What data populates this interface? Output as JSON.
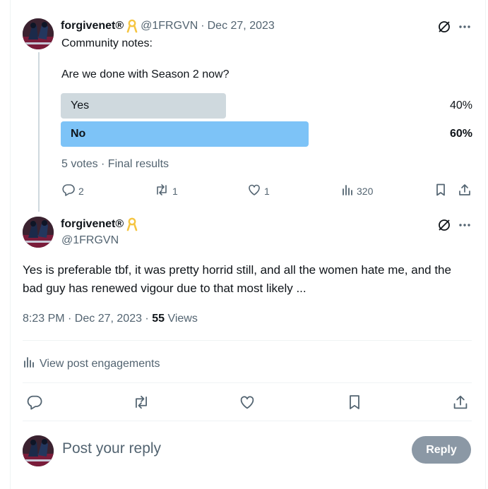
{
  "parent_tweet": {
    "display_name": "forgivenet®",
    "handle": "@1FRGVN",
    "separator": "·",
    "date": "Dec 27, 2023",
    "text_line1": "Community notes:",
    "text_line2": "Are we done with Season 2 now?",
    "poll": {
      "options": [
        {
          "label": "Yes",
          "percent": "40%",
          "share": 0.4,
          "winner": false
        },
        {
          "label": "No",
          "percent": "60%",
          "share": 0.6,
          "winner": true
        }
      ],
      "summary": "5 votes · Final results"
    },
    "actions": {
      "replies": "2",
      "reposts": "1",
      "likes": "1",
      "views": "320"
    }
  },
  "main_tweet": {
    "display_name": "forgivenet®",
    "handle": "@1FRGVN",
    "text": "Yes is preferable tbf, it was pretty horrid still, and all the women hate me, and the bad guy has renewed vigour due to that most likely ...",
    "timestamp": "8:23 PM · Dec 27, 2023 · ",
    "views_count": "55",
    "views_label": " Views",
    "engagements_label": "View post engagements"
  },
  "reply_box": {
    "placeholder": "Post your reply",
    "button_label": "Reply"
  },
  "colors": {
    "winner_bar": "#7dc3f7",
    "loser_bar": "#cfd9de",
    "muted_text": "#536471",
    "reply_button": "#8b98a5"
  },
  "icons": [
    "grok-icon",
    "more-icon",
    "ribbon-icon",
    "reply-icon",
    "repost-icon",
    "like-icon",
    "views-icon",
    "bookmark-icon",
    "share-icon",
    "engagements-icon"
  ]
}
